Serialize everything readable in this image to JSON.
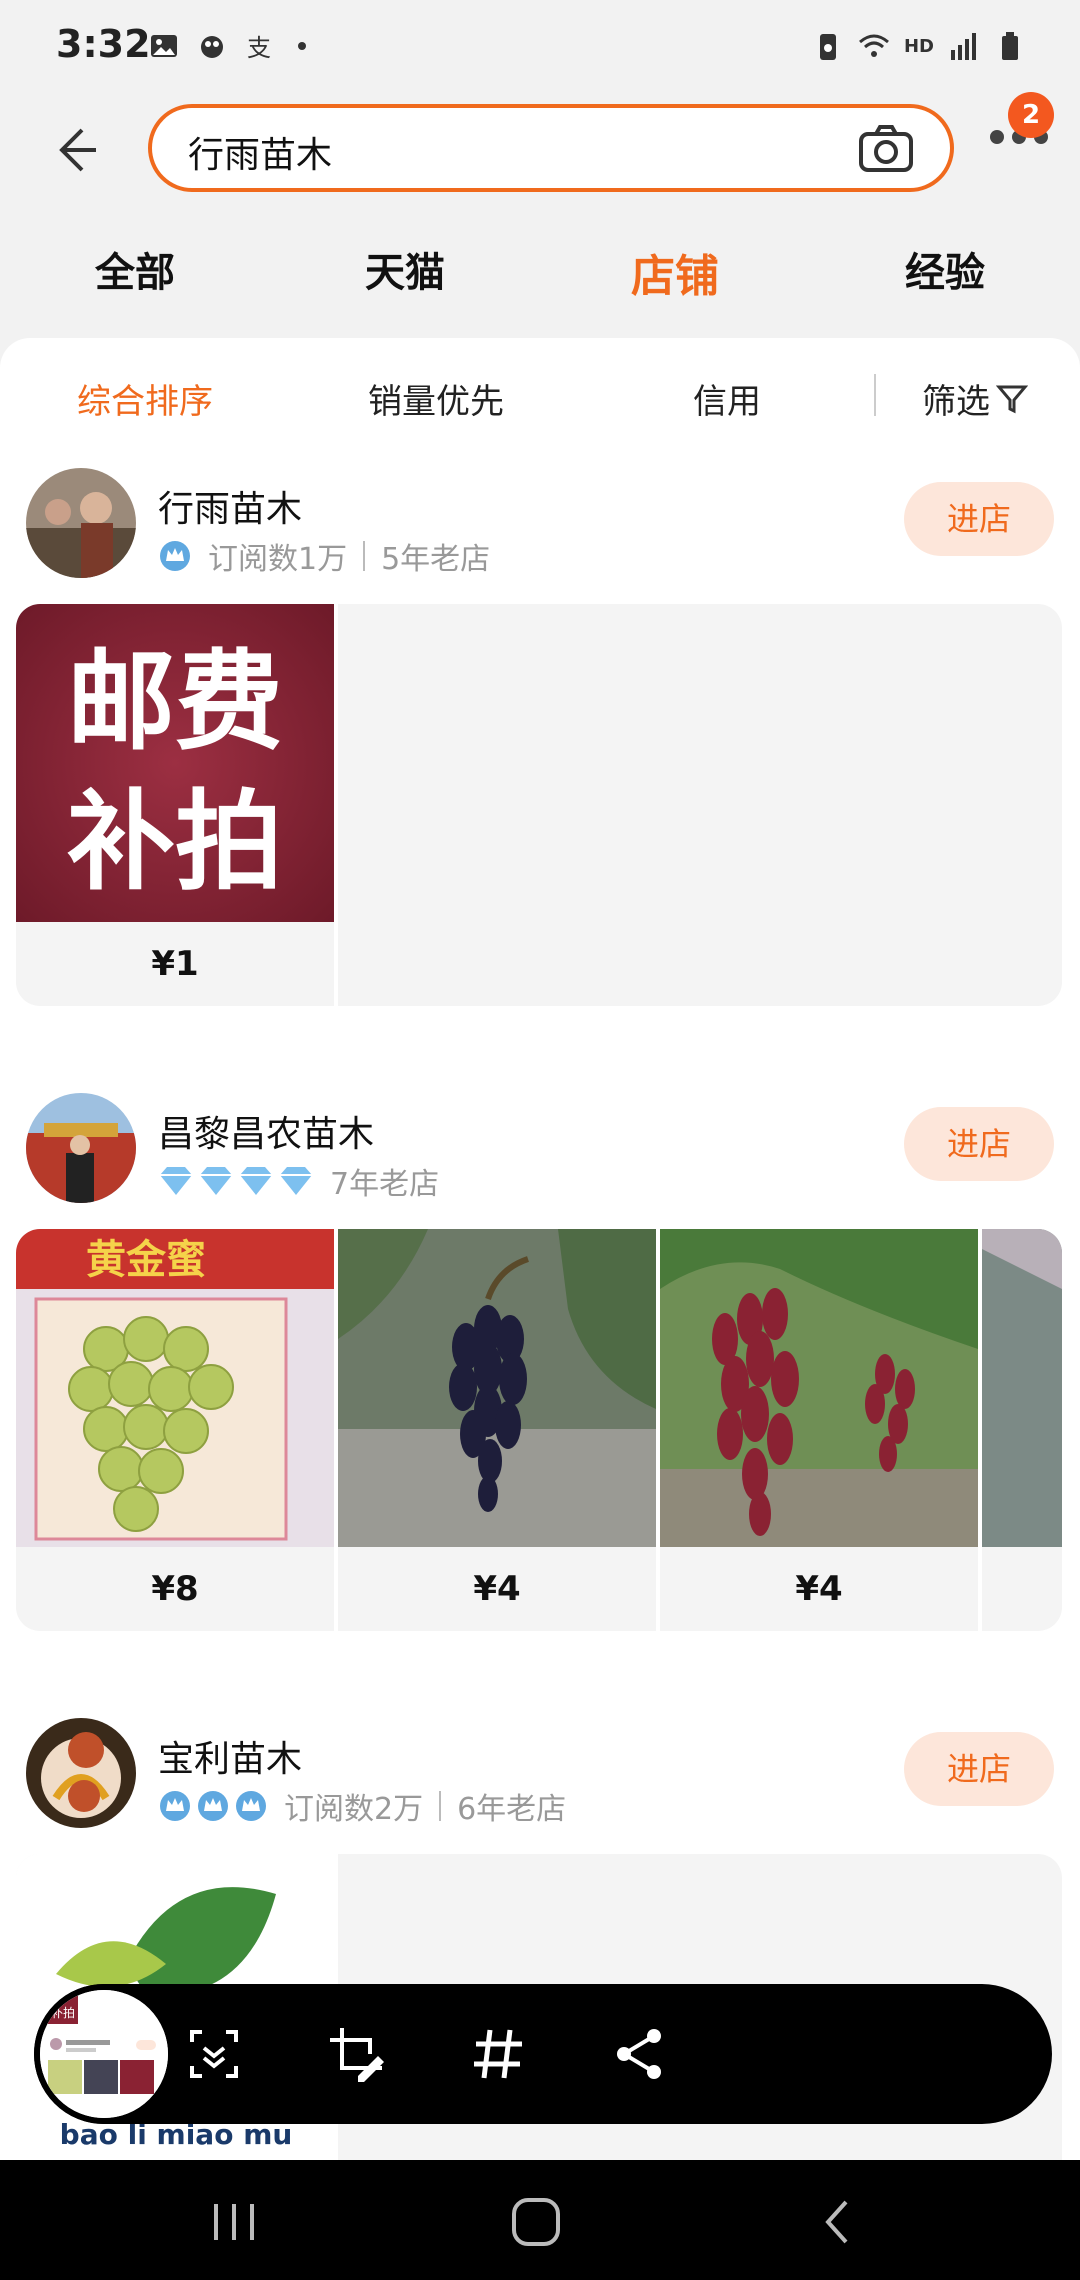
{
  "status_bar": {
    "time": "3:32",
    "network_label": "HD",
    "icons": [
      "gallery-icon",
      "app-icon",
      "alipay-icon",
      "dot-icon",
      "battery-saver-icon",
      "wifi-icon",
      "signal-icon",
      "battery-icon"
    ]
  },
  "header": {
    "search_query": "行雨苗木",
    "notification_count": "2"
  },
  "tabs": [
    {
      "label": "全部"
    },
    {
      "label": "天猫"
    },
    {
      "label": "店铺"
    },
    {
      "label": "经验"
    }
  ],
  "active_tab": "店铺",
  "sort": {
    "items": [
      {
        "label": "综合排序"
      },
      {
        "label": "销量优先"
      },
      {
        "label": "信用"
      }
    ],
    "filter_label": "筛选",
    "active": "综合排序"
  },
  "shops": [
    {
      "name": "行雨苗木",
      "subscribers": "订阅数1万",
      "age": "5年老店",
      "badge_count": 1,
      "enter_label": "进店",
      "products": [
        {
          "price": "¥1",
          "image_text_line1": "邮费",
          "image_text_line2": "补拍"
        }
      ]
    },
    {
      "name": "昌黎昌农苗木",
      "age": "7年老店",
      "badge_count": 4,
      "enter_label": "进店",
      "products": [
        {
          "price": "¥8",
          "image_text": "黄金蜜"
        },
        {
          "price": "¥4"
        },
        {
          "price": "¥4"
        }
      ]
    },
    {
      "name": "宝利苗木",
      "subscribers": "订阅数2万",
      "age": "6年老店",
      "badge_count": 3,
      "enter_label": "进店",
      "products": [
        {
          "image_text": "bao li miao mu"
        }
      ]
    }
  ],
  "colors": {
    "accent": "#f06a1d",
    "enter_bg": "#fde6da",
    "badge": "#f3581f"
  },
  "screenshot_toolbar": {
    "thumb_text": "补拍",
    "buttons": [
      "scroll-capture-icon",
      "crop-edit-icon",
      "hashtag-icon",
      "share-icon"
    ]
  },
  "nav_bar": {
    "buttons": [
      "recents-icon",
      "home-icon",
      "back-icon"
    ]
  }
}
